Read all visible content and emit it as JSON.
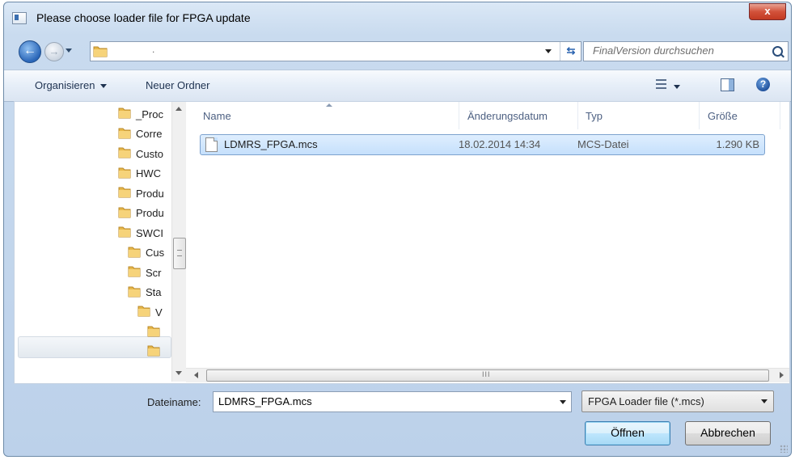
{
  "window": {
    "title": "Please choose loader file for FPGA update",
    "close_label": "x"
  },
  "nav": {
    "back_glyph": "←",
    "forward_glyph": "→",
    "address_text": ".",
    "refresh_glyph": "⇆",
    "search_placeholder": "FinalVersion durchsuchen"
  },
  "toolbar": {
    "organize_label": "Organisieren",
    "new_folder_label": "Neuer Ordner",
    "help_glyph": "?"
  },
  "tree": {
    "items": [
      {
        "label": "_Proc"
      },
      {
        "label": "Corre"
      },
      {
        "label": "Custo"
      },
      {
        "label": "HWC"
      },
      {
        "label": "Produ"
      },
      {
        "label": "Produ"
      },
      {
        "label": "SWCI"
      },
      {
        "label": "Cus"
      },
      {
        "label": "Scr"
      },
      {
        "label": "Sta"
      },
      {
        "label": "V"
      },
      {
        "label": ""
      },
      {
        "label": ""
      }
    ]
  },
  "columns": {
    "name": "Name",
    "date": "Änderungsdatum",
    "type": "Typ",
    "size": "Größe"
  },
  "files": [
    {
      "name": "LDMRS_FPGA.mcs",
      "date": "18.02.2014 14:34",
      "type": "MCS-Datei",
      "size": "1.290 KB"
    }
  ],
  "scrollbar": {
    "grip": "III"
  },
  "footer": {
    "filename_label": "Dateiname:",
    "filename_value": "LDMRS_FPGA.mcs",
    "filetype_value": "FPGA Loader file (*.mcs)",
    "open_label": "Öffnen",
    "cancel_label": "Abbrechen"
  },
  "colors": {
    "folder": "#e8b84a",
    "selection": "#c5e0fc",
    "accent": "#2a66b8"
  }
}
